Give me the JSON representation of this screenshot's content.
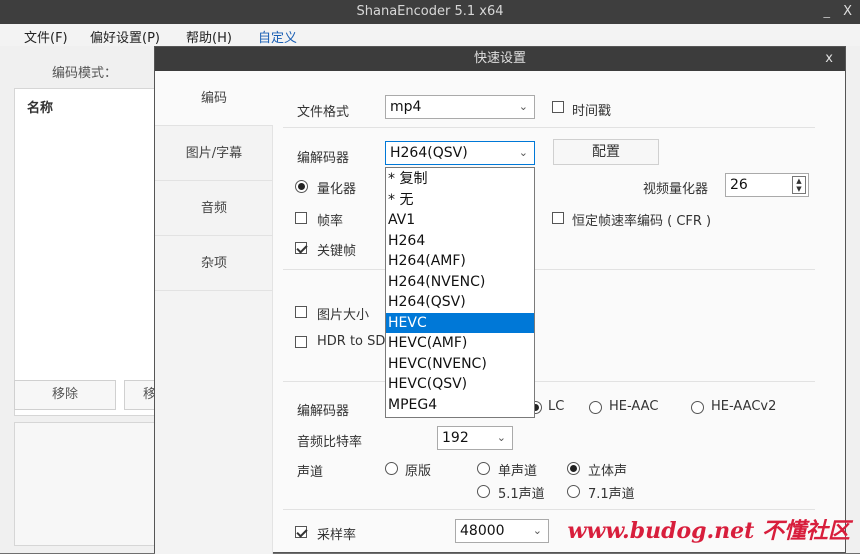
{
  "app": {
    "title": "ShanaEncoder 5.1 x64",
    "minimize": "_",
    "close": "X"
  },
  "menu": [
    "文件(F)",
    "偏好设置(P)",
    "帮助(H)",
    "自定义"
  ],
  "main": {
    "mode_label": "编码模式：",
    "name_header": "名称",
    "remove_button": "移除",
    "cut_button": "移"
  },
  "dialog": {
    "title": "快速设置",
    "close": "x",
    "tabs": [
      "编码",
      "图片/字幕",
      "音频",
      "杂项"
    ],
    "file_format_label": "文件格式",
    "file_format_value": "mp4",
    "timestamp_label": "时间戳",
    "codec_label": "编解码器",
    "codec_value": "H264(QSV)",
    "config_button": "配置",
    "quantizer_label": "量化器",
    "video_quant_label": "视频量化器",
    "video_quant_value": "26",
    "framerate_label": "帧率",
    "cfr_label": "恒定帧速率编码 ( CFR )",
    "keyframe_label": "关键帧",
    "image_size_label": "图片大小",
    "hdr_label": "HDR to SD",
    "audio_codec_label": "编解码器",
    "lc_label": "LC",
    "heaac_label": "HE-AAC",
    "heaacv2_label": "HE-AACv2",
    "bitrate_label": "音频比特率",
    "bitrate_value": "192",
    "channel_label": "声道",
    "orig_label": "原版",
    "mono_label": "单声道",
    "stereo_label": "立体声",
    "ch51_label": "5.1声道",
    "ch71_label": "7.1声道",
    "samplerate_label": "采样率",
    "samplerate_value": "48000"
  },
  "dropdown_options": [
    "* 复制",
    "* 无",
    "AV1",
    "H264",
    "H264(AMF)",
    "H264(NVENC)",
    "H264(QSV)",
    "HEVC",
    "HEVC(AMF)",
    "HEVC(NVENC)",
    "HEVC(QSV)",
    "MPEG4"
  ],
  "dropdown_selected": "HEVC",
  "watermark": "www.budog.net 不懂社区"
}
